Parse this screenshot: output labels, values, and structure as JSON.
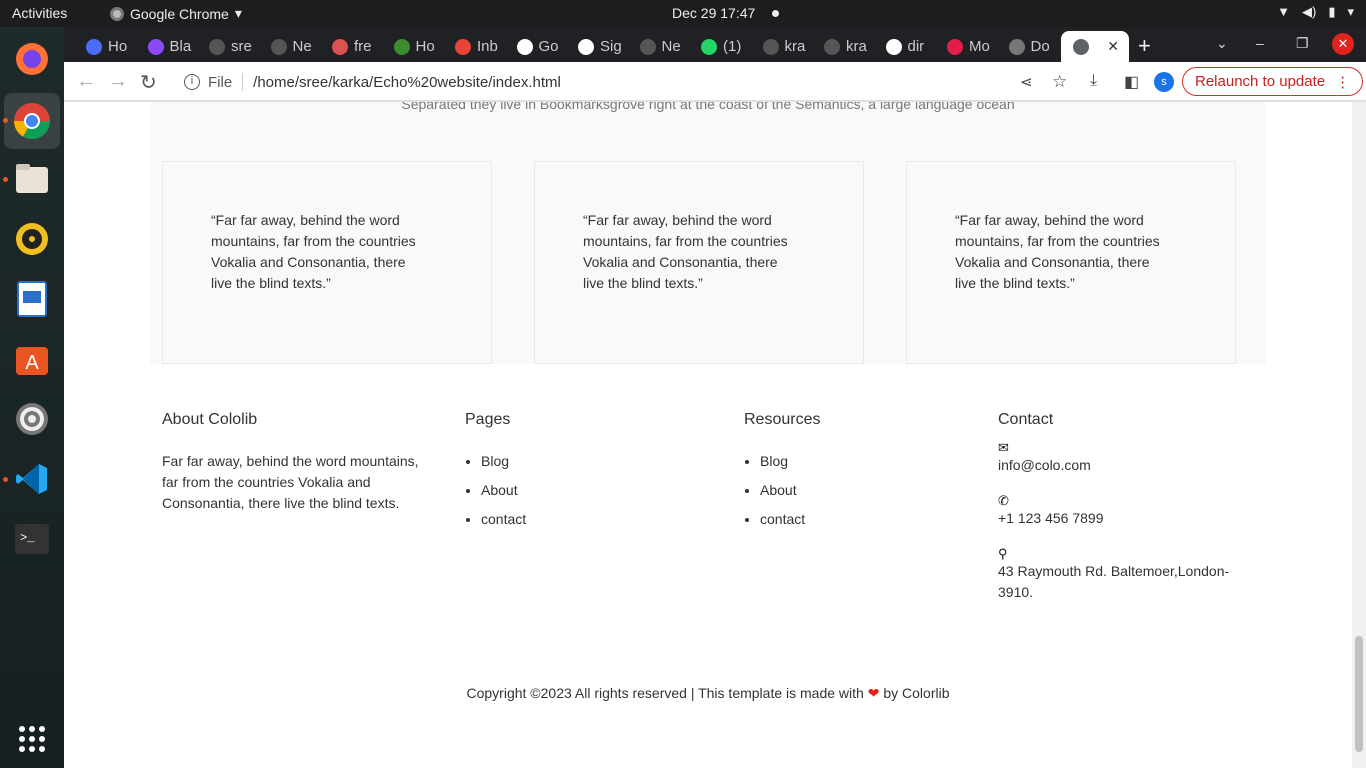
{
  "topbar": {
    "activities": "Activities",
    "app_name": "Google Chrome",
    "clock": "Dec 29  17:47"
  },
  "dock": {
    "items": [
      "firefox-icon",
      "chrome-icon",
      "files-icon",
      "rhythmbox-icon",
      "libreoffice-writer-icon",
      "software-center-icon",
      "settings-icon",
      "vscode-icon",
      "terminal-icon",
      "app-grid-icon"
    ]
  },
  "browser": {
    "tabs": [
      {
        "label": "Ho",
        "color": "#4a6cf7"
      },
      {
        "label": "Bla",
        "color": "#8a4af7"
      },
      {
        "label": "sre",
        "color": "#555555"
      },
      {
        "label": "Ne",
        "color": "#555555"
      },
      {
        "label": "fre",
        "color": "#d9534f"
      },
      {
        "label": "Ho",
        "color": "#3c8d2f"
      },
      {
        "label": "Inb",
        "color": "#ea4335"
      },
      {
        "label": "Go",
        "color": "#ffffff"
      },
      {
        "label": "Sig",
        "color": "#ffffff"
      },
      {
        "label": "Ne",
        "color": "#555555"
      },
      {
        "label": "(1)",
        "color": "#25d366"
      },
      {
        "label": "kra",
        "color": "#555555"
      },
      {
        "label": "kra",
        "color": "#555555"
      },
      {
        "label": "dir",
        "color": "#ffffff"
      },
      {
        "label": "Mo",
        "color": "#e11d48"
      },
      {
        "label": "Do",
        "color": "#777777"
      }
    ],
    "active_tab_close": "✕",
    "omnibox_scheme": "File",
    "url": "/home/sree/karka/Echo%20website/index.html",
    "profile_initial": "s",
    "relaunch_label": "Relaunch to update"
  },
  "page": {
    "testimonial_subtitle": "Separated they live in Bookmarksgrove right at the coast of the Semantics, a large language ocean",
    "testimonials": [
      "“Far far away, behind the word mountains, far from the countries Vokalia and Consonantia, there live the blind texts.”",
      "“Far far away, behind the word mountains, far from the countries Vokalia and Consonantia, there live the blind texts.”",
      "“Far far away, behind the word mountains, far from the countries Vokalia and Consonantia, there live the blind texts.”"
    ],
    "footer": {
      "about_title": "About Cololib",
      "about_text": "Far far away, behind the word mountains, far from the countries Vokalia and Consonantia, there live the blind texts.",
      "pages_title": "Pages",
      "pages_links": [
        "Blog",
        "About",
        "contact"
      ],
      "resources_title": "Resources",
      "resources_links": [
        "Blog",
        "About",
        "contact"
      ],
      "contact_title": "Contact",
      "email": "info@colo.com",
      "phone": "+1 123 456 7899",
      "address": "43 Raymouth Rd. Baltemoer,London-3910."
    },
    "copyright_before": "Copyright ©2023 All rights reserved | This template is made with",
    "copyright_after": "by Colorlib"
  }
}
